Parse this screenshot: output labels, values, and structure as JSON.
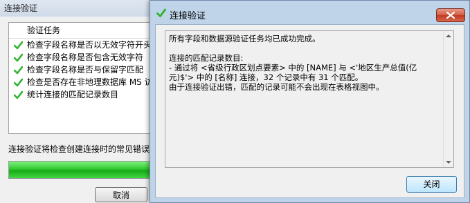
{
  "background_dialog": {
    "title": "连接验证",
    "task_list": {
      "header": "验证任务",
      "items": [
        {
          "label": "检查字段名称是否以无效字符开头"
        },
        {
          "label": "检查字段名称是否包含无效字符"
        },
        {
          "label": "检查字段名称是否与保留字匹配"
        },
        {
          "label": "检查是否存在非地理数据库 MS 访问"
        },
        {
          "label": "统计连接的匹配记录数目"
        }
      ]
    },
    "description": "连接验证将检查创建连接时的常见错误。",
    "progress_percent": 100,
    "cancel_label": "取消"
  },
  "result_dialog": {
    "title": "连接验证",
    "message": "所有字段和数据源验证任务均已成功完成。\n\n连接的匹配记录数目:\n- 通过将 <省级行政区划点要素> 中的 [NAME] 与 <'地区生产总值(亿元)$'> 中的 [名称] 连接，32 个记录中有 31 个匹配。\n由于连接验证出错，匹配的记录可能不会出现在表格视图中。",
    "ok_label": "关闭"
  },
  "colors": {
    "check": "#2db42d",
    "progress": "#17a917",
    "close_button": "#c23a22"
  },
  "icons": {
    "task_status": "green-check-icon",
    "title": "green-check-icon",
    "close": "close-x-icon"
  }
}
